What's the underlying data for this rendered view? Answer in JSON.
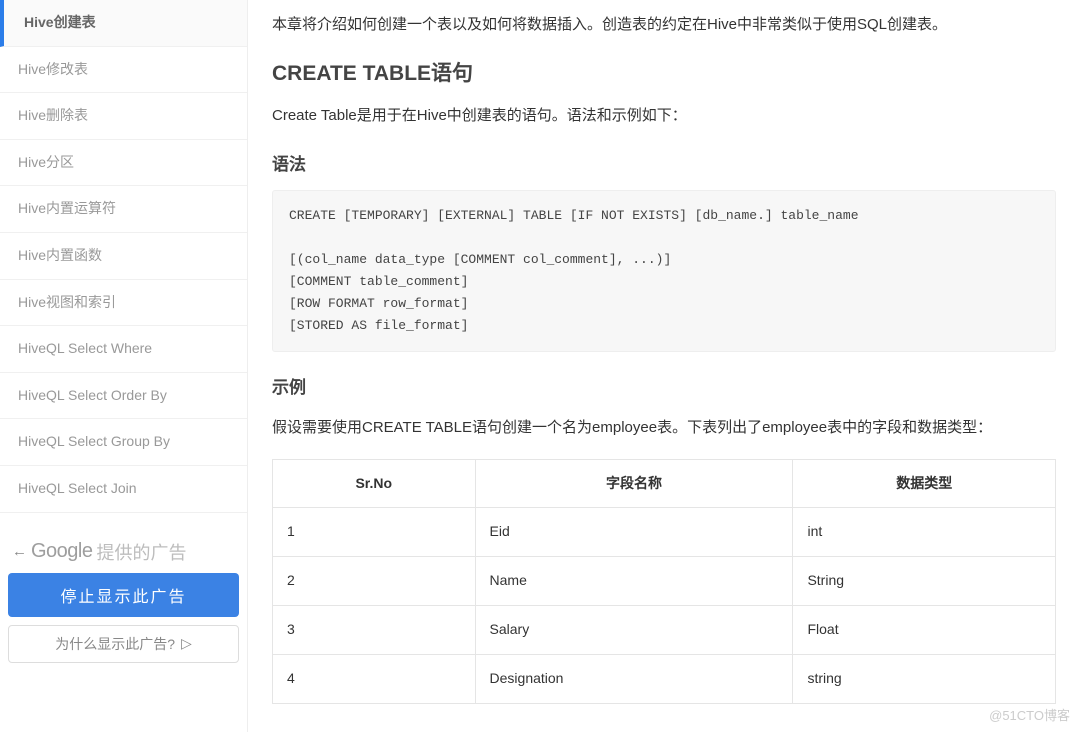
{
  "sidebar": {
    "items": [
      {
        "label": "Hive创建表",
        "active": true
      },
      {
        "label": "Hive修改表",
        "active": false
      },
      {
        "label": "Hive删除表",
        "active": false
      },
      {
        "label": "Hive分区",
        "active": false
      },
      {
        "label": "Hive内置运算符",
        "active": false
      },
      {
        "label": "Hive内置函数",
        "active": false
      },
      {
        "label": "Hive视图和索引",
        "active": false
      },
      {
        "label": "HiveQL Select Where",
        "active": false
      },
      {
        "label": "HiveQL Select Order By",
        "active": false
      },
      {
        "label": "HiveQL Select Group By",
        "active": false
      },
      {
        "label": "HiveQL Select Join",
        "active": false
      }
    ]
  },
  "ad": {
    "google": "Google",
    "provided": "提供的广告",
    "stop": "停止显示此广告",
    "why": "为什么显示此广告?"
  },
  "content": {
    "intro": "本章将介绍如何创建一个表以及如何将数据插入。创造表的约定在Hive中非常类似于使用SQL创建表。",
    "h2_create": "CREATE TABLE语句",
    "create_desc": "Create Table是用于在Hive中创建表的语句。语法和示例如下：",
    "h3_syntax": "语法",
    "code": "CREATE [TEMPORARY] [EXTERNAL] TABLE [IF NOT EXISTS] [db_name.] table_name\n\n[(col_name data_type [COMMENT col_comment], ...)]\n[COMMENT table_comment]\n[ROW FORMAT row_format]\n[STORED AS file_format]",
    "h3_example": "示例",
    "example_desc": "假设需要使用CREATE TABLE语句创建一个名为employee表。下表列出了employee表中的字段和数据类型：",
    "table": {
      "headers": [
        "Sr.No",
        "字段名称",
        "数据类型"
      ],
      "rows": [
        [
          "1",
          "Eid",
          "int"
        ],
        [
          "2",
          "Name",
          "String"
        ],
        [
          "3",
          "Salary",
          "Float"
        ],
        [
          "4",
          "Designation",
          "string"
        ]
      ]
    }
  },
  "watermark": "@51CTO博客"
}
